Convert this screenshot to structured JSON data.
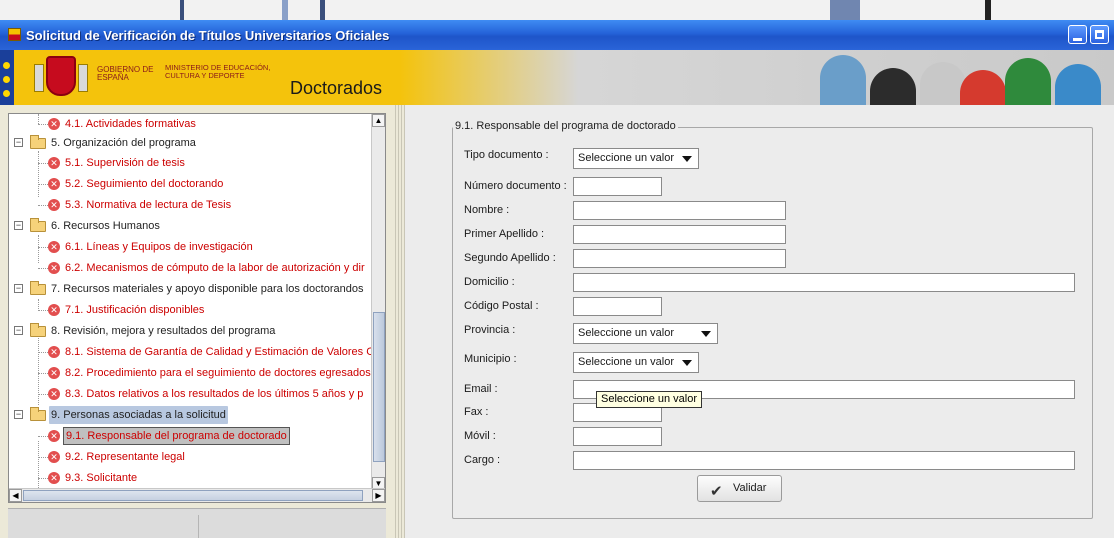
{
  "window": {
    "title": "Solicitud de Verificación de Títulos Universitarios Oficiales"
  },
  "header": {
    "gobierno": "GOBIERNO DE ESPAÑA",
    "ministerio": "MINISTERIO DE EDUCACIÓN, CULTURA Y DEPORTE",
    "app_title": "Doctorados"
  },
  "tree": {
    "items": [
      {
        "label": "4.1. Actividades formativas",
        "kind": "child"
      },
      {
        "label": "5. Organización del programa",
        "kind": "parent"
      },
      {
        "label": "5.1. Supervisión de tesis",
        "kind": "child"
      },
      {
        "label": "5.2. Seguimiento del doctorando",
        "kind": "child"
      },
      {
        "label": "5.3. Normativa de lectura de Tesis",
        "kind": "child"
      },
      {
        "label": "6. Recursos Humanos",
        "kind": "parent"
      },
      {
        "label": "6.1. Líneas y Equipos de investigación",
        "kind": "child"
      },
      {
        "label": "6.2. Mecanismos de cómputo de la labor de autorización y dir",
        "kind": "child"
      },
      {
        "label": "7. Recursos materiales y apoyo disponible para los doctorandos",
        "kind": "parent"
      },
      {
        "label": "7.1. Justificación disponibles",
        "kind": "child"
      },
      {
        "label": "8. Revisión, mejora y resultados del programa",
        "kind": "parent"
      },
      {
        "label": "8.1. Sistema de Garantía de Calidad y Estimación de Valores C",
        "kind": "child"
      },
      {
        "label": "8.2. Procedimiento para el seguimiento de doctores egresados",
        "kind": "child"
      },
      {
        "label": "8.3. Datos relativos a los resultados de los últimos 5 años y p",
        "kind": "child"
      },
      {
        "label": "9. Personas asociadas a la solicitud",
        "kind": "parent",
        "selected": true
      },
      {
        "label": "9.1. Responsable del programa de doctorado",
        "kind": "child",
        "selected": true
      },
      {
        "label": "9.2. Representante legal",
        "kind": "child"
      },
      {
        "label": "9.3. Solicitante",
        "kind": "child"
      }
    ]
  },
  "form": {
    "legend": "9.1. Responsable del programa de doctorado",
    "tipo_documento_label": "Tipo documento :",
    "tipo_documento_value": "Seleccione un valor",
    "numero_documento_label": "Número documento :",
    "nombre_label": "Nombre :",
    "primer_apellido_label": "Primer Apellido :",
    "segundo_apellido_label": "Segundo Apellido :",
    "domicilio_label": "Domicilio :",
    "codigo_postal_label": "Código Postal :",
    "provincia_label": "Provincia :",
    "provincia_value": "Seleccione un valor",
    "municipio_label": "Municipio :",
    "municipio_value": "Seleccione un valor",
    "email_label": "Email :",
    "fax_label": "Fax :",
    "movil_label": "Móvil :",
    "cargo_label": "Cargo :",
    "tooltip": "Seleccione un valor",
    "validar_label": "Validar"
  },
  "colors": {
    "title_bar": "#2462d8",
    "error_red": "#cc0000",
    "header_gold": "#f4c30c"
  }
}
